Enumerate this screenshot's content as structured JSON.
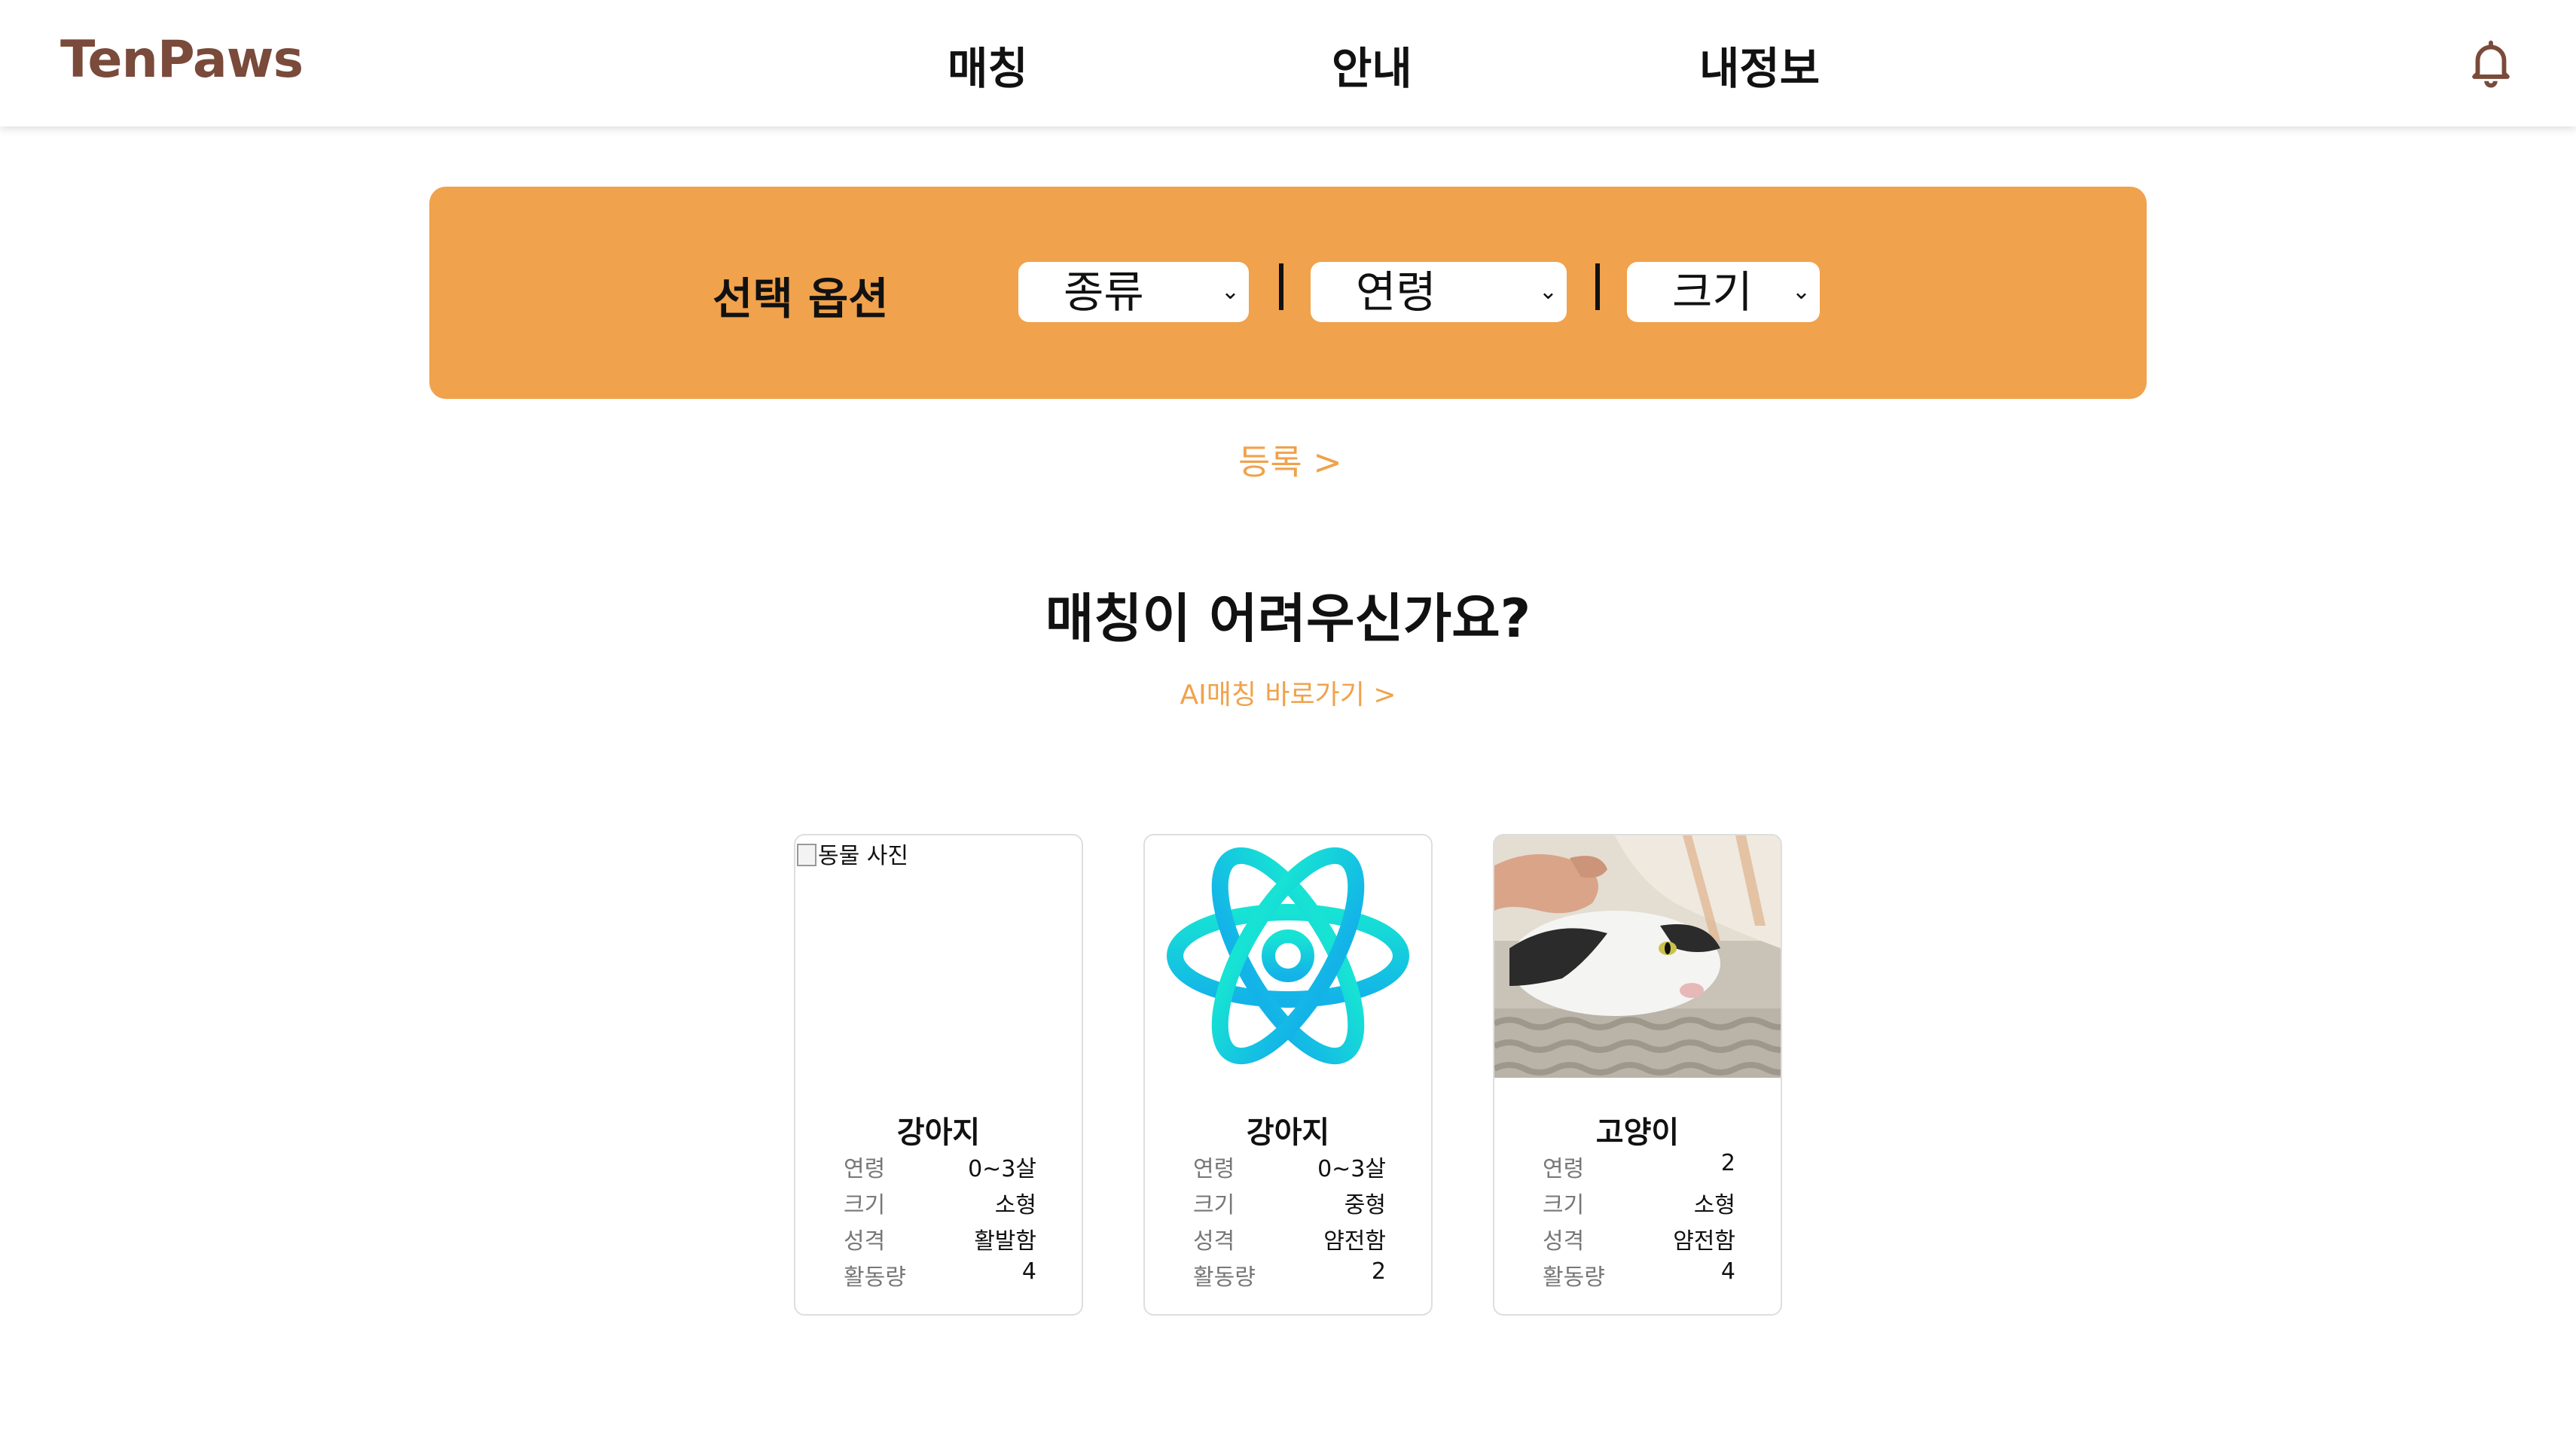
{
  "header": {
    "logo": "TenPaws",
    "nav": [
      "매칭",
      "안내",
      "내정보"
    ]
  },
  "filter": {
    "title": "선택 옵션",
    "selects": [
      {
        "selected": "종류"
      },
      {
        "selected": "연령"
      },
      {
        "selected": "크기"
      }
    ],
    "divider": "|"
  },
  "register_link": "등록 >",
  "headline": "매칭이 어려우신가요?",
  "ai_link": "AI매칭 바로가기 >",
  "colors": {
    "brand": "#7a4a3a",
    "accent": "#f0a24c"
  },
  "cards": [
    {
      "image_alt": "동물 사진",
      "title": "강아지",
      "rows": [
        {
          "label": "연령",
          "value": "0~3살"
        },
        {
          "label": "크기",
          "value": "소형"
        },
        {
          "label": "성격",
          "value": "활발함"
        },
        {
          "label": "활동량",
          "value": "4"
        }
      ]
    },
    {
      "image": "react-logo-icon",
      "title": "강아지",
      "rows": [
        {
          "label": "연령",
          "value": "0~3살"
        },
        {
          "label": "크기",
          "value": "중형"
        },
        {
          "label": "성격",
          "value": "얌전함"
        },
        {
          "label": "활동량",
          "value": "2"
        }
      ]
    },
    {
      "image": "cat-photo",
      "title": "고양이",
      "rows": [
        {
          "label": "연령",
          "value": "2"
        },
        {
          "label": "크기",
          "value": "소형"
        },
        {
          "label": "성격",
          "value": "얌전함"
        },
        {
          "label": "활동량",
          "value": "4"
        }
      ]
    }
  ]
}
